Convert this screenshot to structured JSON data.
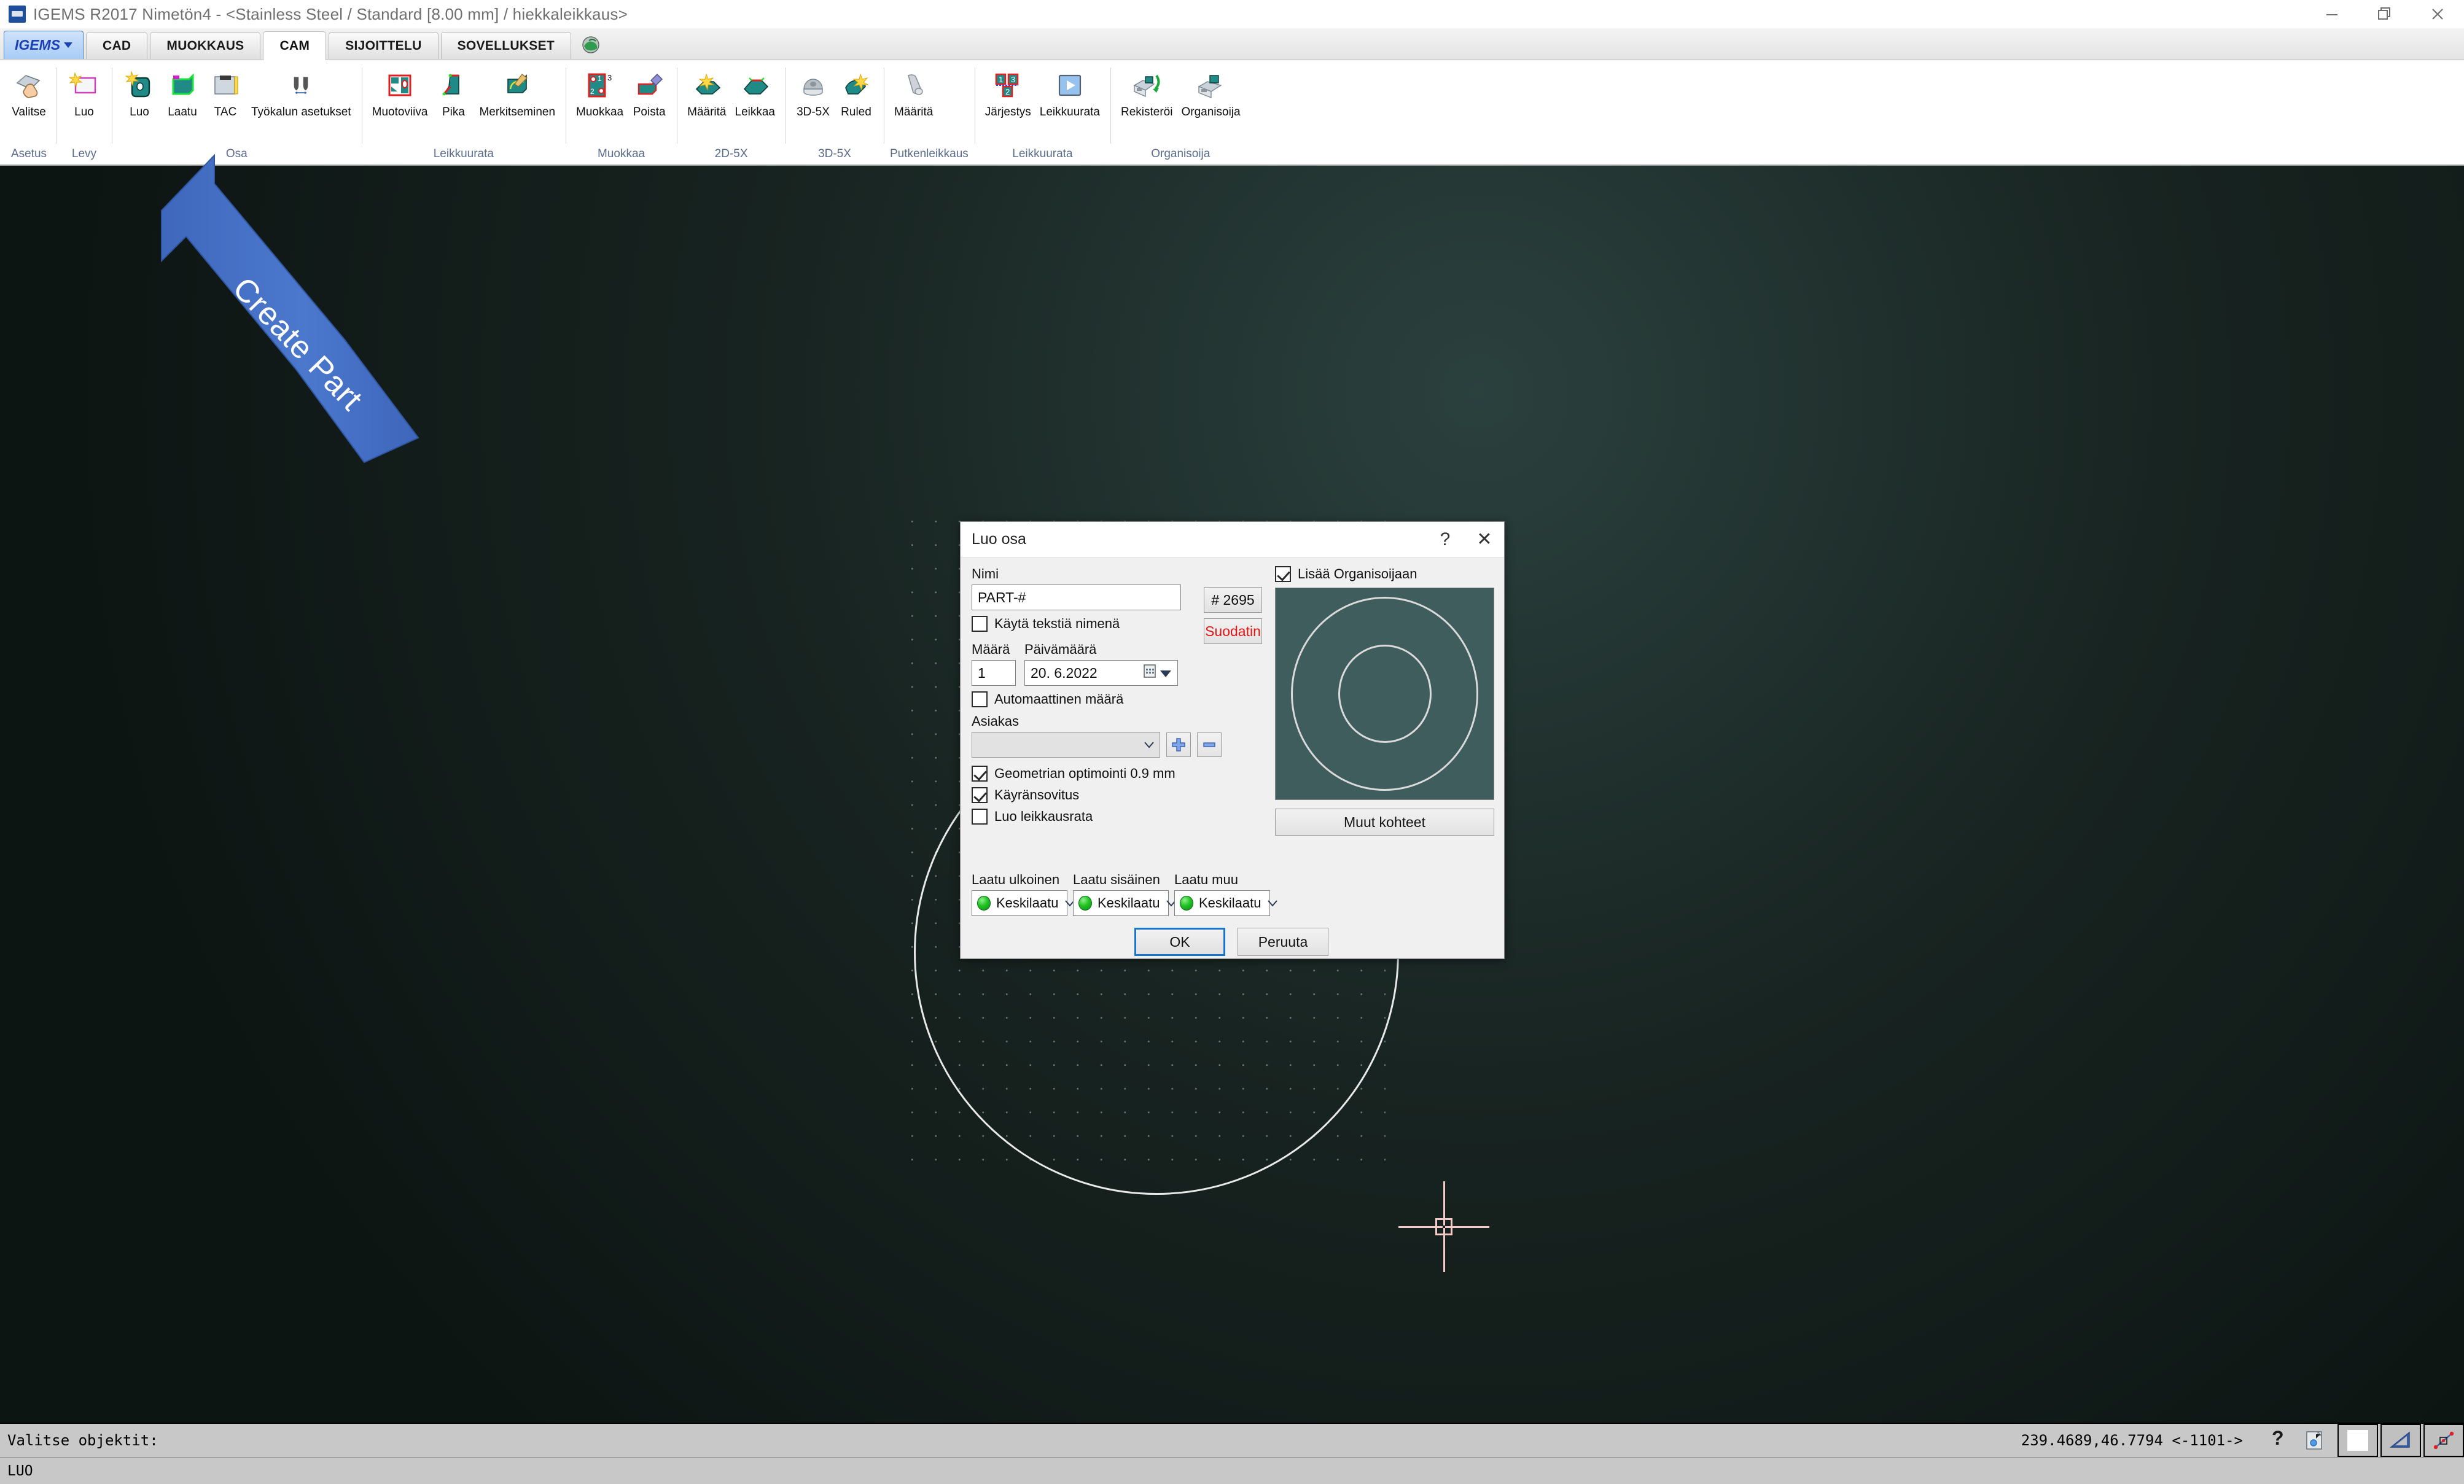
{
  "window": {
    "title": "IGEMS R2017  Nimetön4 - <Stainless Steel / Standard [8.00 mm] / hiekkaleikkaus>",
    "logo_name": "igems-logo",
    "minimize_label": "–",
    "restore_label": "❐",
    "close_label": "✕"
  },
  "ribbon": {
    "app_button": "IGEMS",
    "tabs": [
      {
        "label": "CAD",
        "active": false
      },
      {
        "label": "MUOKKAUS",
        "active": false
      },
      {
        "label": "CAM",
        "active": true
      },
      {
        "label": "SIJOITTELU",
        "active": false
      },
      {
        "label": "SOVELLUKSET",
        "active": false
      }
    ],
    "groups": [
      {
        "title": "Asetus",
        "items": [
          {
            "label": "Valitse",
            "icon": "select-hand-icon"
          }
        ]
      },
      {
        "title": "Levy",
        "items": [
          {
            "label": "Luo",
            "icon": "create-sheet-icon"
          }
        ]
      },
      {
        "title": "Osa",
        "items": [
          {
            "label": "Luo",
            "icon": "create-part-icon"
          },
          {
            "label": "Laatu",
            "icon": "quality-icon"
          },
          {
            "label": "TAC",
            "icon": "tac-icon"
          },
          {
            "label": "Työkalun asetukset",
            "icon": "tool-settings-icon"
          }
        ]
      },
      {
        "title": "Leikkuurata",
        "items": [
          {
            "label": "Muotoviiva",
            "icon": "contour-line-icon"
          },
          {
            "label": "Pika",
            "icon": "quick-icon"
          },
          {
            "label": "Merkitseminen",
            "icon": "marking-icon"
          }
        ]
      },
      {
        "title": "Muokkaa",
        "items": [
          {
            "label": "Muokkaa",
            "icon": "edit-order-icon"
          },
          {
            "label": "Poista",
            "icon": "delete-eraser-icon"
          }
        ]
      },
      {
        "title": "2D-5X",
        "items": [
          {
            "label": "Määritä",
            "icon": "define-bevel-icon"
          },
          {
            "label": "Leikkaa",
            "icon": "cut-bevel-icon"
          }
        ]
      },
      {
        "title": "3D-5X",
        "items": [
          {
            "label": "3D-5X",
            "icon": "dome-3d-icon"
          },
          {
            "label": "Ruled",
            "icon": "ruled-surface-icon"
          }
        ]
      },
      {
        "title": "Putkenleikkaus",
        "items": [
          {
            "label": "Määritä",
            "icon": "tube-cut-icon"
          }
        ]
      },
      {
        "title": "Leikkuurata",
        "items": [
          {
            "label": "Järjestys",
            "icon": "sequence-icon"
          },
          {
            "label": "Leikkuurata",
            "icon": "play-simulate-icon"
          }
        ]
      },
      {
        "title": "Organisoija",
        "items": [
          {
            "label": "Rekisteröi",
            "icon": "register-archive-icon"
          },
          {
            "label": "Organisoija",
            "icon": "organizer-box-icon"
          }
        ]
      }
    ]
  },
  "annotation": {
    "label": "Create Part",
    "color": "#4472c4"
  },
  "dialog": {
    "title": "Luo osa",
    "help_label": "?",
    "close_label": "✕",
    "name_label": "Nimi",
    "name_value": "PART-#",
    "number_button": "# 2695",
    "filter_button": "Suodatin",
    "filter_color": "#e11616",
    "use_text_as_name_label": "Käytä tekstiä nimenä",
    "use_text_as_name_checked": false,
    "quantity_label": "Määrä",
    "quantity_value": "1",
    "date_label": "Päivämäärä",
    "date_value": "20.  6.2022",
    "auto_quantity_label": "Automaattinen määrä",
    "auto_quantity_checked": false,
    "customer_label": "Asiakas",
    "customer_value": "",
    "add_customer_icon": "plus-icon",
    "remove_customer_icon": "minus-icon",
    "geometry_opt_label": "Geometrian optimointi 0.9 mm",
    "geometry_opt_checked": true,
    "curve_fit_label": "Käyränsovitus",
    "curve_fit_checked": true,
    "create_cutpath_label": "Luo leikkausrata",
    "create_cutpath_checked": false,
    "add_to_organizer_label": "Lisää Organisoijaan",
    "add_to_organizer_checked": true,
    "other_objects_button": "Muut kohteet",
    "quality_outer_label": "Laatu ulkoinen",
    "quality_outer_value": "Keskilaatu",
    "quality_inner_label": "Laatu sisäinen",
    "quality_inner_value": "Keskilaatu",
    "quality_other_label": "Laatu muu",
    "quality_other_value": "Keskilaatu",
    "quality_dot_color": "#22c322",
    "ok_button": "OK",
    "cancel_button": "Peruuta",
    "preview_bg": "#3f5d5c"
  },
  "status": {
    "prompt": "Valitse objektit:",
    "command": "LUO",
    "coordinates": "239.4689,46.7794 <-1101->",
    "icons": [
      {
        "name": "help-question-icon"
      },
      {
        "name": "document-snap-icon"
      }
    ],
    "toggles": [
      {
        "name": "blank-toggle"
      },
      {
        "name": "ortho-triangle-toggle"
      },
      {
        "name": "snap-point-toggle"
      }
    ]
  }
}
